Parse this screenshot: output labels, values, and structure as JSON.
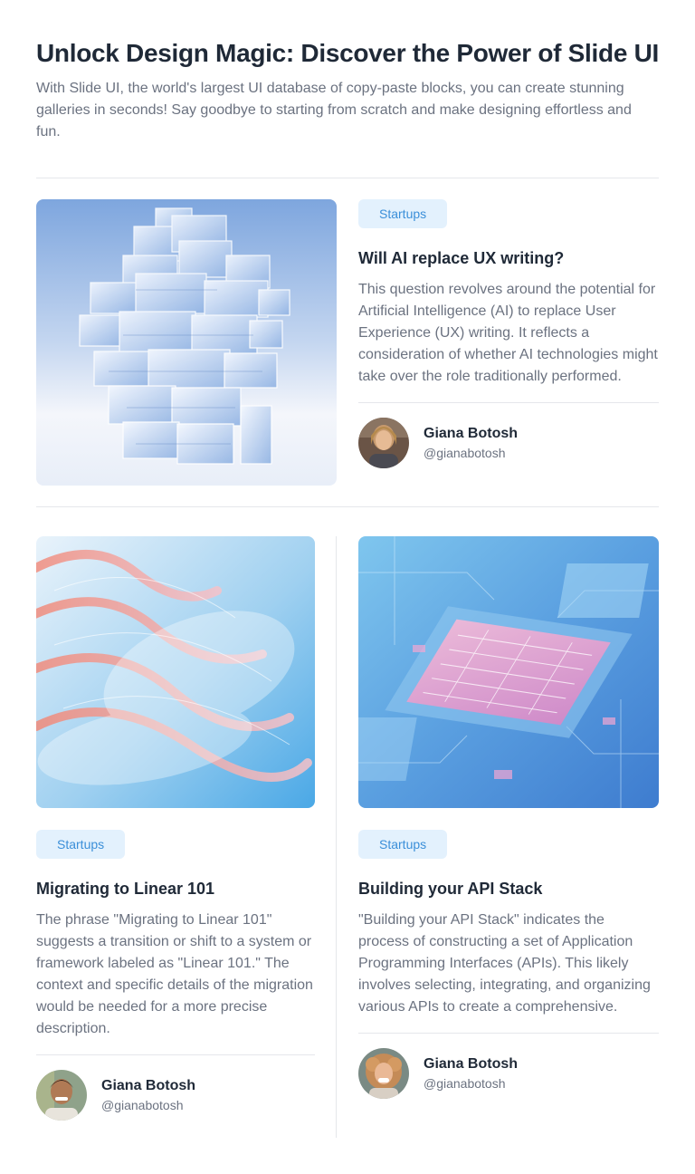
{
  "header": {
    "title": "Unlock Design Magic: Discover the Power of Slide UI",
    "subtitle": "With Slide UI, the world's largest UI database of copy-paste blocks, you can create stunning galleries in seconds! Say goodbye to starting from scratch and make designing effortless and fun."
  },
  "posts": [
    {
      "tag": "Startups",
      "title": "Will AI replace UX writing?",
      "excerpt": "This question revolves around the potential for Artificial Intelligence (AI) to replace User Experience (UX) writing. It reflects a consideration of whether AI technologies might take over the role traditionally performed.",
      "author": {
        "name": "Giana Botosh",
        "handle": "@gianabotosh"
      }
    },
    {
      "tag": "Startups",
      "title": "Migrating to Linear 101",
      "excerpt": "The phrase \"Migrating to Linear 101\" suggests a transition or shift to a system or framework labeled as \"Linear 101.\" The context and specific details of the migration would be needed for a more precise description.",
      "author": {
        "name": "Giana Botosh",
        "handle": "@gianabotosh"
      }
    },
    {
      "tag": "Startups",
      "title": "Building your API Stack",
      "excerpt": "\"Building your API Stack\" indicates the process of constructing a set of Application Programming Interfaces (APIs). This likely involves selecting, integrating, and organizing various APIs to create a comprehensive.",
      "author": {
        "name": "Giana Botosh",
        "handle": "@gianabotosh"
      }
    }
  ],
  "colors": {
    "tag_bg": "#e3f1fd",
    "tag_text": "#3b8fd9",
    "divider": "#e5e7eb",
    "muted_text": "#6b7280"
  }
}
